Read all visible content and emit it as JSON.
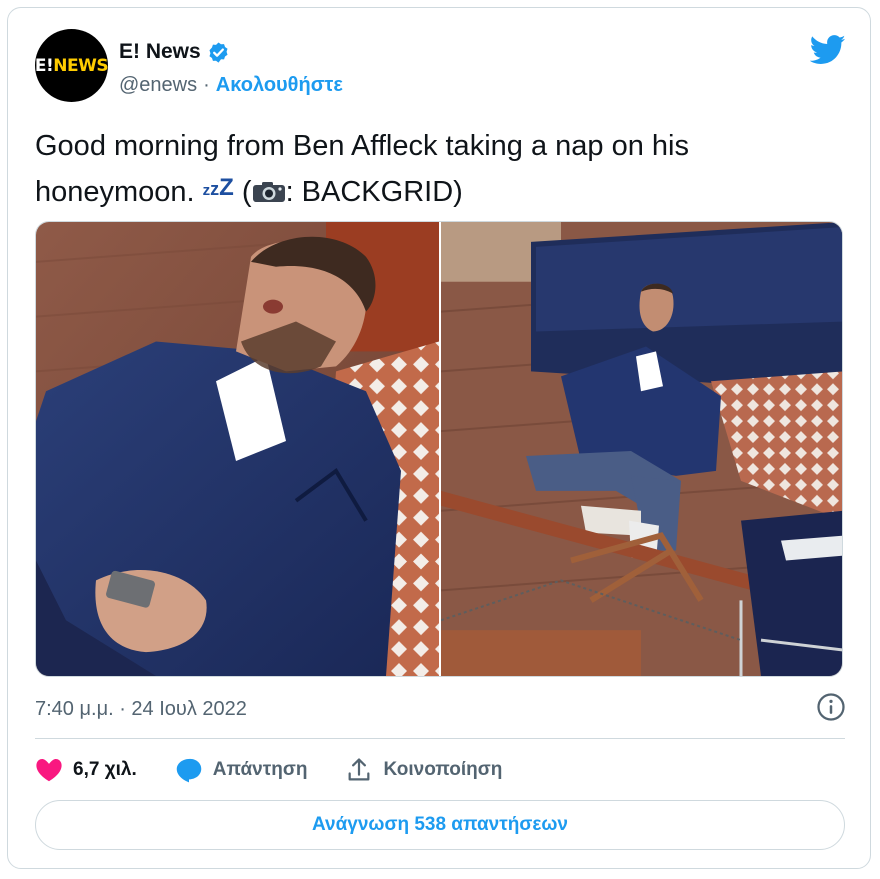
{
  "tweet": {
    "author_name": "E! News",
    "handle": "@enews",
    "separator": "·",
    "follow_label": "Ακολουθήστε",
    "avatar_text_e": "E!",
    "avatar_text_news": "NEWS",
    "text_line1": "Good morning from Ben Affleck taking a nap on his",
    "text_line2_start": "honeymoon. ",
    "zz_small": "z",
    "zz_mid": "z",
    "zz_big": "Z",
    "text_paren_open": " (",
    "text_credit": ": BACKGRID)",
    "timestamp": "7:40 μ.μ. · 24 Ιουλ 2022"
  },
  "actions": {
    "like_count": "6,7 χιλ.",
    "reply_label": "Απάντηση",
    "share_label": "Κοινοποίηση"
  },
  "read_replies_label": "Ανάγνωση 538 απαντήσεων",
  "colors": {
    "accent": "#1d9bf0",
    "like": "#f91880",
    "muted": "#536471",
    "border": "#cfd9de"
  },
  "icons": [
    "verified-badge-icon",
    "twitter-bird-icon",
    "camera-icon",
    "info-icon",
    "heart-icon",
    "reply-bubble-icon",
    "share-icon"
  ]
}
